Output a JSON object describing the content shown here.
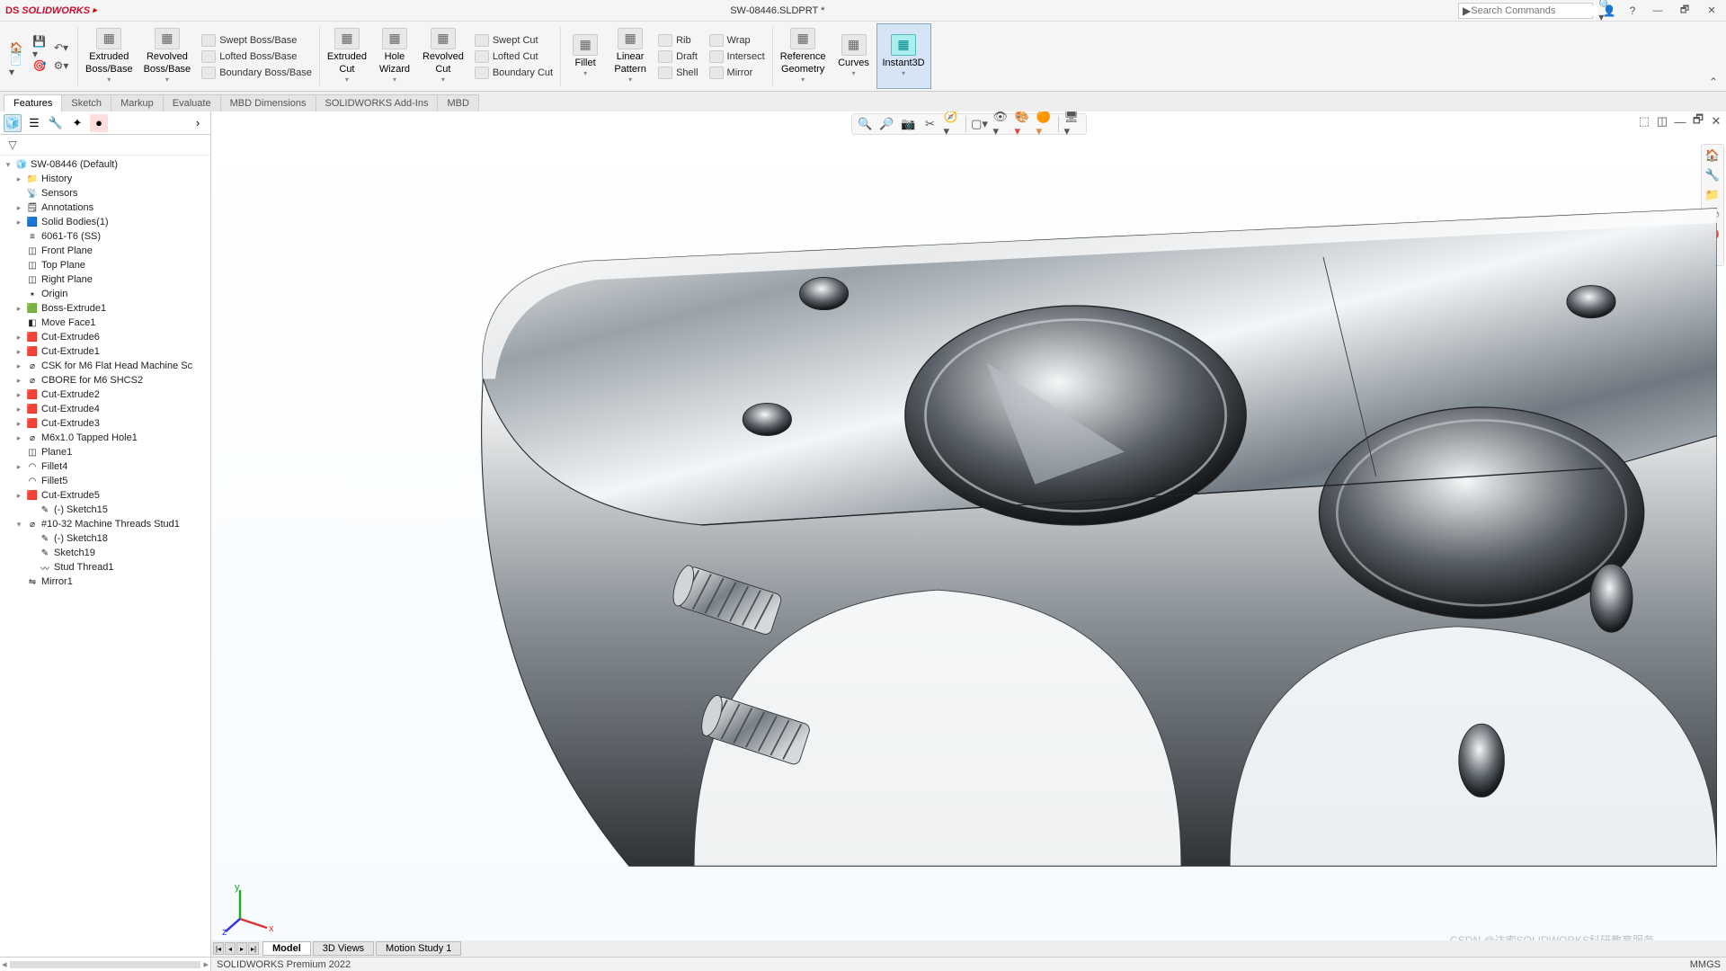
{
  "app": {
    "brand": "SOLIDWORKS",
    "title": "SW-08446.SLDPRT *"
  },
  "search": {
    "placeholder": "Search Commands"
  },
  "ribbon": {
    "big": [
      {
        "name": "extruded-boss",
        "l1": "Extruded",
        "l2": "Boss/Base"
      },
      {
        "name": "revolved-boss",
        "l1": "Revolved",
        "l2": "Boss/Base"
      }
    ],
    "bossCol": [
      {
        "name": "swept-boss",
        "label": "Swept Boss/Base"
      },
      {
        "name": "lofted-boss",
        "label": "Lofted Boss/Base"
      },
      {
        "name": "boundary-boss",
        "label": "Boundary Boss/Base"
      }
    ],
    "cutBig": [
      {
        "name": "extruded-cut",
        "l1": "Extruded",
        "l2": "Cut"
      },
      {
        "name": "hole-wizard",
        "l1": "Hole",
        "l2": "Wizard"
      },
      {
        "name": "revolved-cut",
        "l1": "Revolved",
        "l2": "Cut"
      }
    ],
    "cutCol": [
      {
        "name": "swept-cut",
        "label": "Swept Cut"
      },
      {
        "name": "lofted-cut",
        "label": "Lofted Cut"
      },
      {
        "name": "boundary-cut",
        "label": "Boundary Cut"
      }
    ],
    "featBig": [
      {
        "name": "fillet",
        "l1": "Fillet",
        "l2": ""
      },
      {
        "name": "linear-pattern",
        "l1": "Linear",
        "l2": "Pattern"
      }
    ],
    "featCol": [
      {
        "name": "rib",
        "label": "Rib"
      },
      {
        "name": "draft",
        "label": "Draft"
      },
      {
        "name": "shell",
        "label": "Shell"
      }
    ],
    "featCol2": [
      {
        "name": "wrap",
        "label": "Wrap"
      },
      {
        "name": "intersect",
        "label": "Intersect"
      },
      {
        "name": "mirror",
        "label": "Mirror"
      }
    ],
    "right": [
      {
        "name": "reference-geometry",
        "l1": "Reference",
        "l2": "Geometry"
      },
      {
        "name": "curves",
        "l1": "Curves",
        "l2": ""
      },
      {
        "name": "instant3d",
        "l1": "Instant3D",
        "l2": "",
        "pressed": true
      }
    ]
  },
  "featureTabs": [
    "Features",
    "Sketch",
    "Markup",
    "Evaluate",
    "MBD Dimensions",
    "SOLIDWORKS Add-Ins",
    "MBD"
  ],
  "tree": {
    "rootName": "SW-08446  (Default)",
    "items": [
      {
        "indent": 1,
        "exp": "▸",
        "icon": "📁",
        "label": "History"
      },
      {
        "indent": 1,
        "exp": "",
        "icon": "📡",
        "label": "Sensors"
      },
      {
        "indent": 1,
        "exp": "▸",
        "icon": "🗒",
        "label": "Annotations"
      },
      {
        "indent": 1,
        "exp": "▸",
        "icon": "🟦",
        "label": "Solid Bodies(1)"
      },
      {
        "indent": 1,
        "exp": "",
        "icon": "≡",
        "label": "6061-T6 (SS)"
      },
      {
        "indent": 1,
        "exp": "",
        "icon": "◫",
        "label": "Front Plane"
      },
      {
        "indent": 1,
        "exp": "",
        "icon": "◫",
        "label": "Top Plane"
      },
      {
        "indent": 1,
        "exp": "",
        "icon": "◫",
        "label": "Right Plane"
      },
      {
        "indent": 1,
        "exp": "",
        "icon": "⭑",
        "label": "Origin"
      },
      {
        "indent": 1,
        "exp": "▸",
        "icon": "🟩",
        "label": "Boss-Extrude1"
      },
      {
        "indent": 1,
        "exp": "",
        "icon": "◧",
        "label": "Move Face1"
      },
      {
        "indent": 1,
        "exp": "▸",
        "icon": "🟥",
        "label": "Cut-Extrude6"
      },
      {
        "indent": 1,
        "exp": "▸",
        "icon": "🟥",
        "label": "Cut-Extrude1"
      },
      {
        "indent": 1,
        "exp": "▸",
        "icon": "⌀",
        "label": "CSK for M6 Flat Head Machine Sc"
      },
      {
        "indent": 1,
        "exp": "▸",
        "icon": "⌀",
        "label": "CBORE for M6 SHCS2"
      },
      {
        "indent": 1,
        "exp": "▸",
        "icon": "🟥",
        "label": "Cut-Extrude2"
      },
      {
        "indent": 1,
        "exp": "▸",
        "icon": "🟥",
        "label": "Cut-Extrude4"
      },
      {
        "indent": 1,
        "exp": "▸",
        "icon": "🟥",
        "label": "Cut-Extrude3"
      },
      {
        "indent": 1,
        "exp": "▸",
        "icon": "⌀",
        "label": "M6x1.0 Tapped Hole1"
      },
      {
        "indent": 1,
        "exp": "",
        "icon": "◫",
        "label": "Plane1"
      },
      {
        "indent": 1,
        "exp": "▸",
        "icon": "◠",
        "label": "Fillet4"
      },
      {
        "indent": 1,
        "exp": "",
        "icon": "◠",
        "label": "Fillet5"
      },
      {
        "indent": 1,
        "exp": "▸",
        "icon": "🟥",
        "label": "Cut-Extrude5"
      },
      {
        "indent": 2,
        "exp": "",
        "icon": "✎",
        "label": "(-) Sketch15"
      },
      {
        "indent": 1,
        "exp": "▾",
        "icon": "⌀",
        "label": "#10-32 Machine Threads Stud1"
      },
      {
        "indent": 2,
        "exp": "",
        "icon": "✎",
        "label": "(-) Sketch18"
      },
      {
        "indent": 2,
        "exp": "",
        "icon": "✎",
        "label": "Sketch19"
      },
      {
        "indent": 2,
        "exp": "",
        "icon": "〰",
        "label": "Stud Thread1"
      },
      {
        "indent": 1,
        "exp": "",
        "icon": "⇋",
        "label": "Mirror1"
      }
    ]
  },
  "bottomTabs": [
    "Model",
    "3D Views",
    "Motion Study 1"
  ],
  "status": {
    "left": "SOLIDWORKS Premium 2022",
    "right": "MMGS"
  },
  "watermark": "CSDN @达索SOLIDWORKS科研教育服务"
}
